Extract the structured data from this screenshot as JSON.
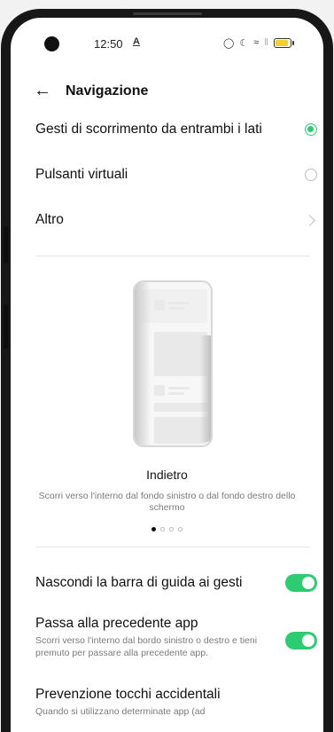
{
  "status_bar": {
    "time": "12:50",
    "notification_icon": "A",
    "icons": [
      "alarm-icon",
      "dnd-moon-icon",
      "wifi-icon",
      "signal-icon",
      "battery-icon"
    ]
  },
  "header": {
    "title": "Navigazione"
  },
  "options": [
    {
      "label": "Gesti di scorrimento da entrambi i lati",
      "selected": true
    },
    {
      "label": "Pulsanti virtuali",
      "selected": false
    },
    {
      "label": "Altro",
      "type": "chevron"
    }
  ],
  "tutorial": {
    "title": "Indietro",
    "description": "Scorri verso l'interno dal fondo sinistro o dal fondo destro dello schermo",
    "page_count": 4,
    "active_page": 1
  },
  "settings": {
    "hide_bar": {
      "title": "Nascondi la barra di guida ai gesti",
      "enabled": true
    },
    "previous_app": {
      "title": "Passa alla precedente app",
      "description": "Scorri verso l'interno dal bordo sinistro o destro e tieni premuto per passare alla precedente app.",
      "enabled": true
    },
    "accidental_touch": {
      "title": "Prevenzione tocchi accidentali",
      "description": "Quando si utilizzano determinate app (ad"
    }
  },
  "colors": {
    "accent": "#2ecc71",
    "battery": "#f2cf2f"
  }
}
